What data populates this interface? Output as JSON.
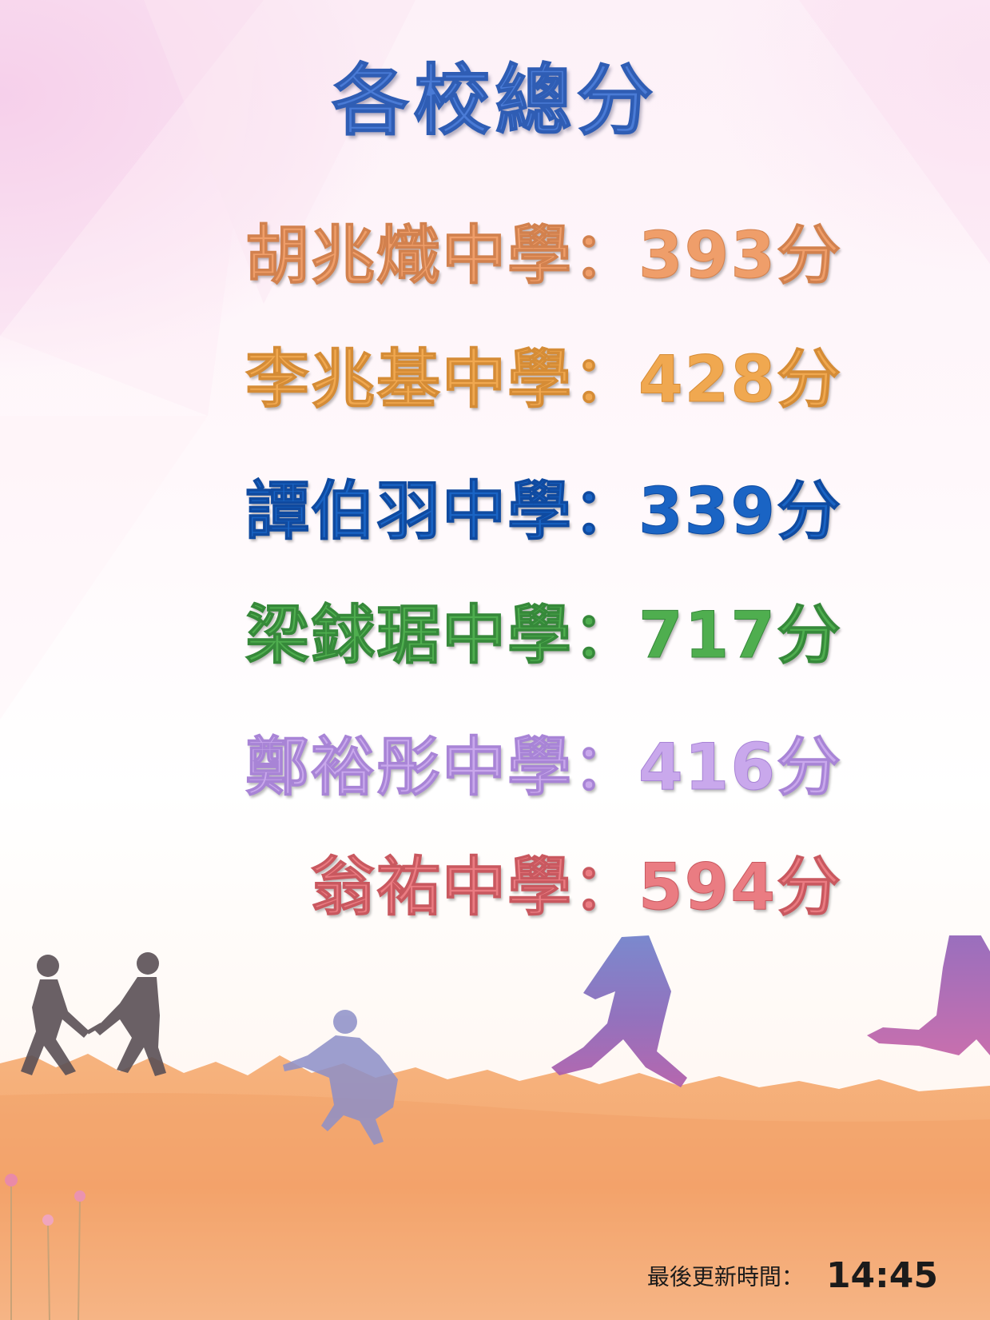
{
  "title": "各校總分",
  "scores": [
    {
      "school": "胡兆熾中學",
      "points": "393分",
      "color": "#ef9e6a"
    },
    {
      "school": "李兆基中學",
      "points": "428分",
      "color": "#f0a850"
    },
    {
      "school": "譚伯羽中學",
      "points": "339分",
      "color": "#1a64c4"
    },
    {
      "school": "梁銶琚中學",
      "points": "717分",
      "color": "#4fae4f"
    },
    {
      "school": "鄭裕彤中學",
      "points": "416分",
      "color": "#c9a8ec"
    },
    {
      "school": "翁祐中學",
      "points": "594分",
      "color": "#ea7c82"
    }
  ],
  "separator": "：",
  "footer": {
    "updated_label": "最後更新時間：",
    "updated_time": "14:45"
  },
  "icons": [
    "relay-baton-runners-silhouette",
    "kneeling-runner-silhouette",
    "sprinting-runner-silhouette"
  ]
}
